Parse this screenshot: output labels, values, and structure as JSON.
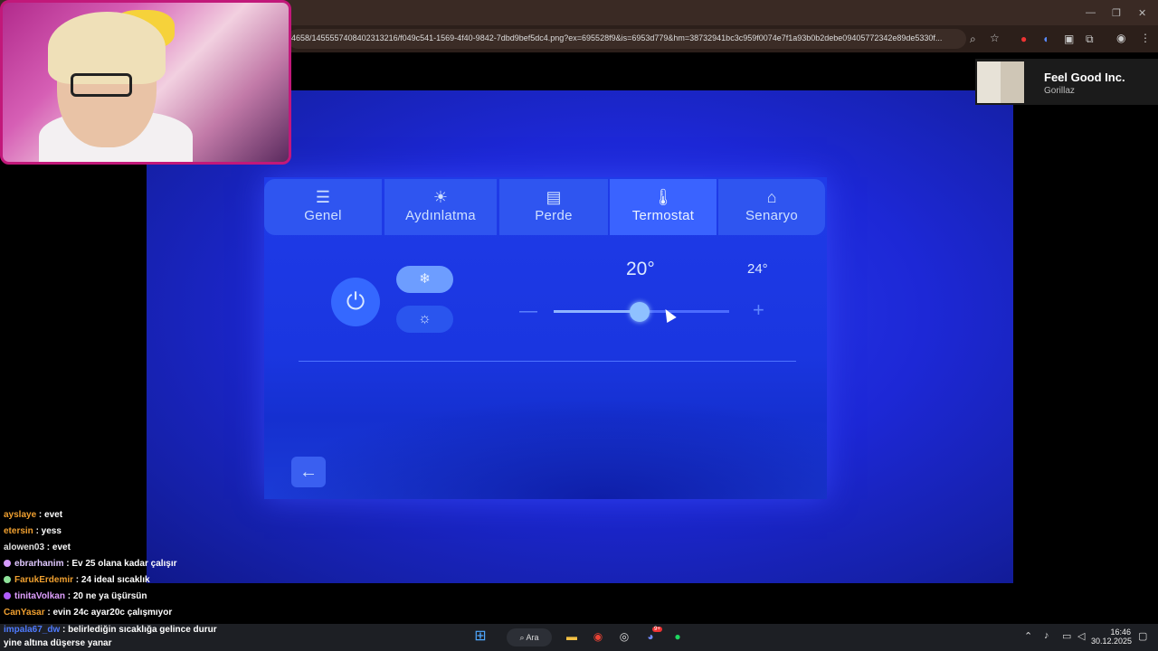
{
  "browser": {
    "url": "4658/1455557408402313216/f049c541-1569-4f40-9842-7dbd9bef5dc4.png?ex=695528f9&is=6953d779&hm=38732941bc3c959f0074e7f1a93b0b2debe09405772342e89de5330f...",
    "window_minimize": "—",
    "window_restore": "❐",
    "window_close": "✕"
  },
  "thermostat_panel": {
    "tabs": [
      {
        "label": "Genel",
        "icon": "sliders-icon"
      },
      {
        "label": "Aydınlatma",
        "icon": "lightbulb-icon"
      },
      {
        "label": "Perde",
        "icon": "curtain-icon"
      },
      {
        "label": "Termostat",
        "icon": "thermometer-icon",
        "active": true
      },
      {
        "label": "Senaryo",
        "icon": "home-icon"
      }
    ],
    "current_temp": "20°",
    "target_temp": "24°",
    "slider_fraction": 0.49,
    "minus_label": "—",
    "plus_label": "+",
    "cool_icon": "❄",
    "heat_icon": "☼",
    "power_icon": "⏻",
    "back_icon": "←"
  },
  "now_playing": {
    "title": "Feel Good Inc.",
    "artist": "Gorillaz"
  },
  "chat": [
    {
      "user": "ayslaye",
      "text": " : evet",
      "color": "#f0a030"
    },
    {
      "user": "etersin",
      "text": " : yess",
      "color": "#f0a030"
    },
    {
      "user": "alowen03",
      "text": " : evet",
      "color": "#e0e0e0"
    },
    {
      "user": "ebrarhanim",
      "text": " : Ev 25 olana kadar çalışır",
      "color": "#e0c8ff",
      "badge": "#d79cff"
    },
    {
      "user": "FarukErdemir",
      "text": " : 24 ideal sıcaklık",
      "color": "#f0a030",
      "badge": "#8fe39a"
    },
    {
      "user": "tinitaVolkan",
      "text": " : 20 ne ya üşürsün",
      "color": "#e0a0ff",
      "badge": "#b05cff"
    },
    {
      "user": "CanYasar",
      "text": " : evin 24c ayar20c çalışmıyor",
      "color": "#f0a030"
    },
    {
      "user": "impala67_dw",
      "text": " : belirlediğin sıcaklığa gelince durur",
      "color": "#4f7bff"
    },
    {
      "user": "",
      "text": "yine altına düşerse yanar",
      "color": "#fff"
    }
  ],
  "taskbar": {
    "search_label": "Ara",
    "time": "16:46",
    "date": "30.12.2025",
    "discord_badge": "9+"
  }
}
